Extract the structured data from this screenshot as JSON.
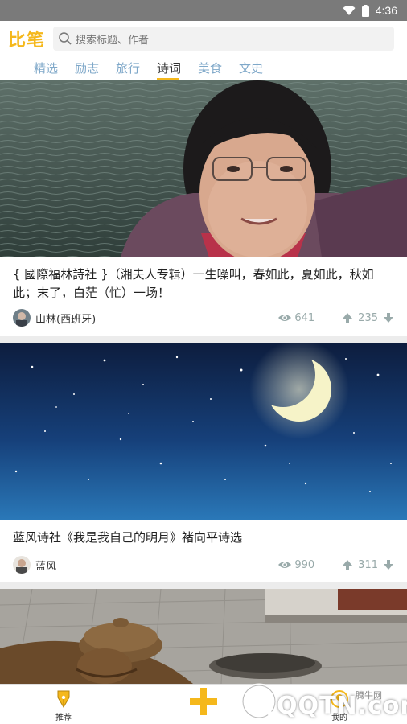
{
  "status_bar": {
    "time": "4:36"
  },
  "header": {
    "logo": "比笔",
    "search_placeholder": "搜索标题、作者"
  },
  "tabs": [
    {
      "label": "精选",
      "active": false
    },
    {
      "label": "励志",
      "active": false
    },
    {
      "label": "旅行",
      "active": false
    },
    {
      "label": "诗词",
      "active": true
    },
    {
      "label": "美食",
      "active": false
    },
    {
      "label": "文史",
      "active": false
    }
  ],
  "posts": [
    {
      "title": "{ 國際福林詩社 }（湘夫人专辑）一生噪叫，春如此，夏如此，秋如此；末了，白茫（忙）一场！",
      "author": "山林(西班牙)",
      "views": "641",
      "votes": "235"
    },
    {
      "title": "蓝风诗社《我是我自己的明月》褚向平诗选",
      "author": "蓝风",
      "views": "990",
      "votes": "311"
    }
  ],
  "bottom_nav": {
    "recommend_label": "推荐",
    "mine_label": "我的"
  },
  "watermark": {
    "brand": "QQTN.com",
    "small": "腾牛网"
  },
  "colors": {
    "accent": "#f5b81c",
    "tab_inactive": "#7fa8c9",
    "meta_gray": "#99aaaa"
  }
}
